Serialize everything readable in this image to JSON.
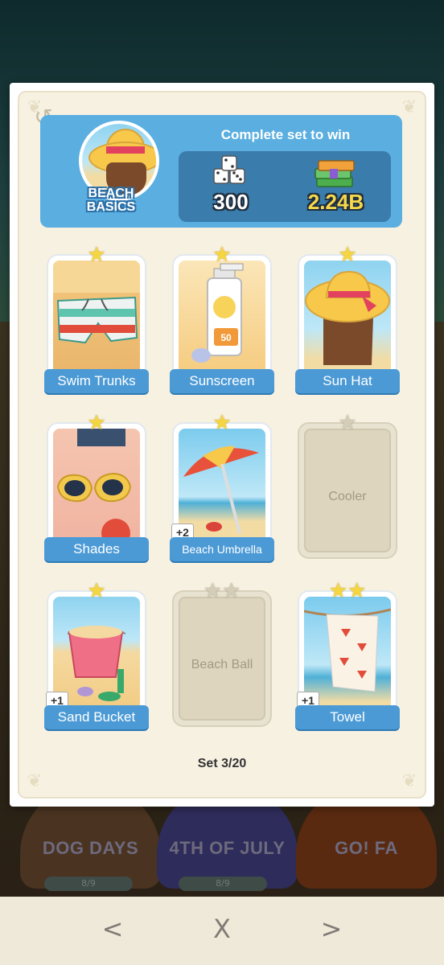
{
  "background": {
    "medals": [
      "DOG DAYS",
      "4TH OF JULY",
      "GO! FA"
    ],
    "pills": [
      "8/9",
      "8/9"
    ]
  },
  "header": {
    "set_title": "BEACH BASICS",
    "reward_title": "Complete set to win",
    "dice_reward": "300",
    "cash_reward": "2.24B"
  },
  "stickers": [
    {
      "name": "Swim Trunks",
      "stars": 1,
      "collected": true,
      "extra": ""
    },
    {
      "name": "Sunscreen",
      "stars": 1,
      "collected": true,
      "extra": ""
    },
    {
      "name": "Sun Hat",
      "stars": 1,
      "collected": true,
      "extra": ""
    },
    {
      "name": "Shades",
      "stars": 1,
      "collected": true,
      "extra": ""
    },
    {
      "name": "Beach Umbrella",
      "stars": 1,
      "collected": true,
      "extra": "+2"
    },
    {
      "name": "Cooler",
      "stars": 1,
      "collected": false,
      "extra": ""
    },
    {
      "name": "Sand Bucket",
      "stars": 1,
      "collected": true,
      "extra": "+1"
    },
    {
      "name": "Beach Ball",
      "stars": 2,
      "collected": false,
      "extra": ""
    },
    {
      "name": "Towel",
      "stars": 2,
      "collected": true,
      "extra": "+1"
    }
  ],
  "sunscreen_spf": "50",
  "progress": "Set 3/20",
  "nav": {
    "prev": "<",
    "close": "X",
    "next": ">"
  },
  "colors": {
    "banner": "#5aaee0",
    "label": "#4b9ad6",
    "star": "#f6d640"
  }
}
